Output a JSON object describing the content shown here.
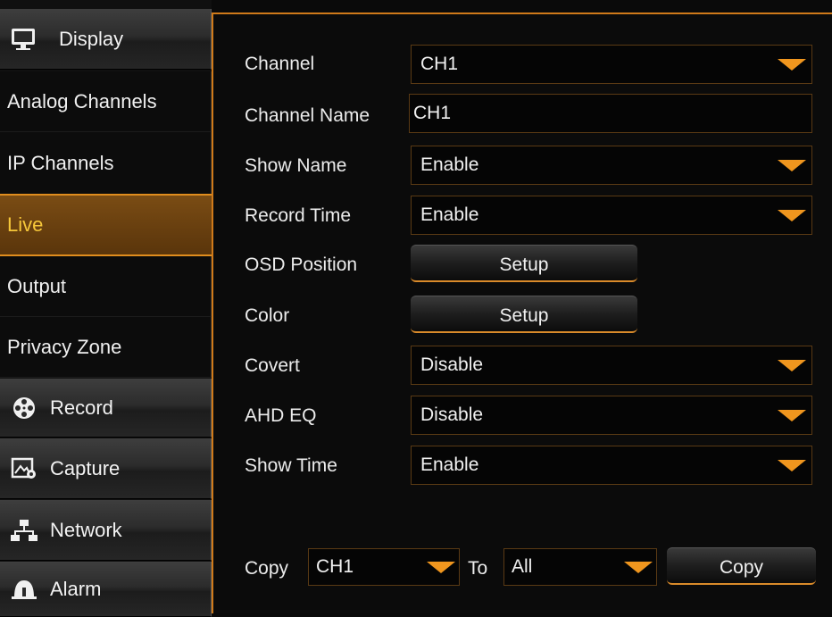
{
  "sidebar": {
    "display_label": "Display",
    "sub_items": [
      "Analog Channels",
      "IP Channels",
      "Live",
      "Output",
      "Privacy Zone"
    ],
    "record_label": "Record",
    "capture_label": "Capture",
    "network_label": "Network",
    "alarm_label": "Alarm"
  },
  "form": {
    "channel_label": "Channel",
    "channel_value": "CH1",
    "channel_name_label": "Channel Name",
    "channel_name_value": "CH1",
    "show_name_label": "Show Name",
    "show_name_value": "Enable",
    "record_time_label": "Record Time",
    "record_time_value": "Enable",
    "osd_position_label": "OSD Position",
    "osd_setup_label": "Setup",
    "color_label": "Color",
    "color_setup_label": "Setup",
    "covert_label": "Covert",
    "covert_value": "Disable",
    "ahd_eq_label": "AHD EQ",
    "ahd_eq_value": "Disable",
    "show_time_label": "Show Time",
    "show_time_value": "Enable"
  },
  "copy_bar": {
    "copy_label": "Copy",
    "from_value": "CH1",
    "to_label": "To",
    "to_value": "All",
    "copy_button": "Copy"
  },
  "colors": {
    "accent": "#e08d1e",
    "active_text": "#f6c73a"
  }
}
